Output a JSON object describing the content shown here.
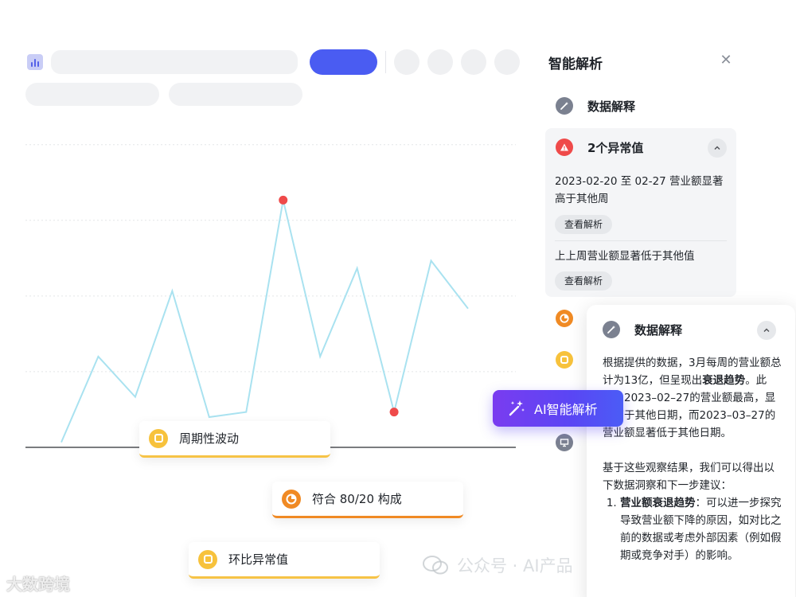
{
  "panel": {
    "title": "智能解析",
    "data_explain_label": "数据解释",
    "anomaly_title": "2个异常值",
    "anomaly_1_text": "2023-02-20 至 02-27 营业额显著高于其他周",
    "anomaly_2_text": "上上周营业额显著低于其他值",
    "view_button_label": "查看解析"
  },
  "explain_card": {
    "title": "数据解释",
    "p1_a": "根据提供的数据，3月每周的营业额总计为13亿，但呈现出",
    "p1_bold": "衰退趋势",
    "p1_b": "。此外，2023–02–27的营业额最高，显著高于其他日期，而2023–03–27的营业额显著低于其他日期。",
    "p2": "基于这些观察结果，我们可以得出以下数据洞察和下一步建议：",
    "item1_bold": "营业额衰退趋势",
    "item1_text": "：可以进一步探究导致营业额下降的原因，如对比之前的数据或考虑外部因素（例如假期或竞争对手）的影响。"
  },
  "tags": {
    "periodic": "周期性波动",
    "pareto": "符合 80/20 构成",
    "mom": "环比异常值"
  },
  "ai_button": {
    "label": "AI智能解析"
  },
  "watermarks": {
    "left": "大数跨境",
    "right": "公众号 · AI产品"
  },
  "colors": {
    "accent_blue": "#4a5cf2",
    "line": "#a9e2f0",
    "anomaly_red": "#ef4a4a",
    "tag_yellow": "#f7c23c",
    "tag_orange": "#f08a24"
  },
  "chart_data": {
    "type": "line",
    "x": [
      1,
      2,
      3,
      4,
      5,
      6,
      7,
      8,
      9,
      10,
      11,
      12
    ],
    "values": [
      2,
      36,
      20,
      62,
      12,
      14,
      98,
      36,
      71,
      14,
      74,
      55
    ],
    "anomaly_indices": [
      6,
      9
    ],
    "ylim": [
      0,
      130
    ],
    "grid": true,
    "title": "",
    "xlabel": "",
    "ylabel": ""
  }
}
